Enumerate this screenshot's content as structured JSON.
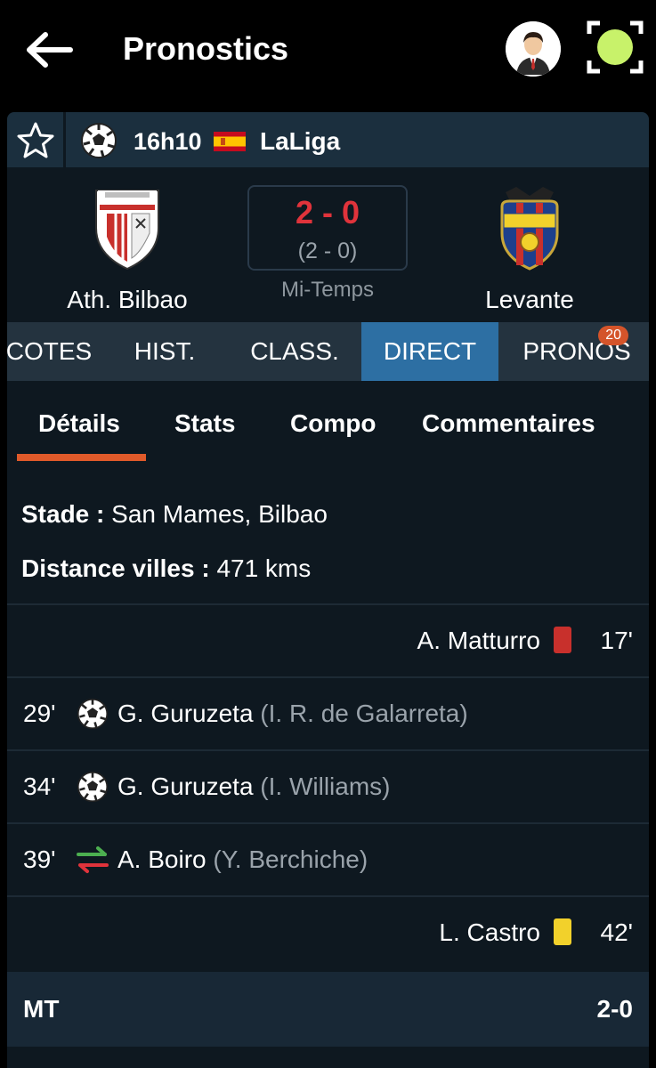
{
  "header": {
    "title": "Pronostics"
  },
  "match": {
    "kickoff": "16h10",
    "league": "LaLiga",
    "home_team": "Ath. Bilbao",
    "away_team": "Levante",
    "score": "2 - 0",
    "half_time_score": "(2 - 0)",
    "status": "Mi-Temps"
  },
  "tabs": [
    {
      "label": "COTES"
    },
    {
      "label": "HIST."
    },
    {
      "label": "CLASS."
    },
    {
      "label": "DIRECT",
      "active": true
    },
    {
      "label": "PRONOS",
      "badge": "20"
    }
  ],
  "subtabs": [
    {
      "label": "Détails",
      "active": true
    },
    {
      "label": "Stats"
    },
    {
      "label": "Compo"
    },
    {
      "label": "Commentaires"
    }
  ],
  "details": {
    "stadium_label": "Stade :",
    "stadium_value": "San Mames, Bilbao",
    "distance_label": "Distance villes :",
    "distance_value": "471 kms"
  },
  "events": [
    {
      "minute": "17'",
      "player": "A. Matturro",
      "assist": "",
      "type": "red-card",
      "side": "away"
    },
    {
      "minute": "29'",
      "player": "G. Guruzeta",
      "assist": "(I. R. de Galarreta)",
      "type": "goal",
      "side": "home"
    },
    {
      "minute": "34'",
      "player": "G. Guruzeta",
      "assist": "(I. Williams)",
      "type": "goal",
      "side": "home"
    },
    {
      "minute": "39'",
      "player": "A. Boiro",
      "assist": "(Y. Berchiche)",
      "type": "substitution",
      "side": "home"
    },
    {
      "minute": "42'",
      "player": "L. Castro",
      "assist": "",
      "type": "yellow-card",
      "side": "away"
    }
  ],
  "half_time": {
    "label": "MT",
    "score": "2-0"
  },
  "colors": {
    "accent_blue": "#2d6fa3",
    "accent_orange": "#e05a2a",
    "score_red": "#e0333b",
    "card_red": "#c8302c",
    "card_yellow": "#f2d12b",
    "scan_green": "#c8f26a"
  },
  "icons": {
    "back": "arrow-left-icon",
    "profile": "avatar-icon",
    "scan": "scan-icon",
    "favorite": "star-icon",
    "sport": "soccer-ball-icon",
    "flag": "spain-flag-icon"
  }
}
